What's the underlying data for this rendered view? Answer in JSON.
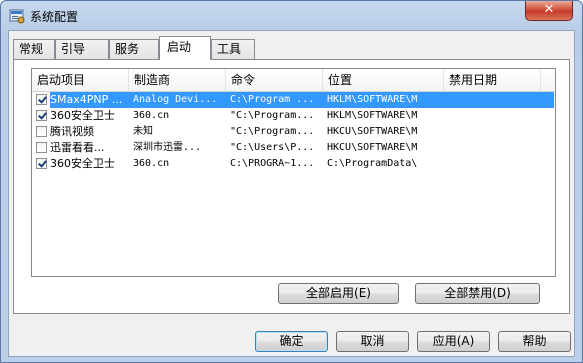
{
  "window": {
    "title": "系统配置",
    "close_label": "✕"
  },
  "tabs": [
    {
      "label": "常规",
      "active": false
    },
    {
      "label": "引导",
      "active": false
    },
    {
      "label": "服务",
      "active": false
    },
    {
      "label": "启动",
      "active": true
    },
    {
      "label": "工具",
      "active": false
    }
  ],
  "startup_list": {
    "columns": [
      "启动项目",
      "制造商",
      "命令",
      "位置",
      "禁用日期"
    ],
    "rows": [
      {
        "checked": true,
        "selected": true,
        "name": "SMax4PNP ...",
        "maker": "Analog Devi...",
        "command": "C:\\Program ...",
        "location": "HKLM\\SOFTWARE\\M...",
        "disabled_date": ""
      },
      {
        "checked": true,
        "selected": false,
        "name": "360安全卫士",
        "maker": "360.cn",
        "command": "\"C:\\Program...",
        "location": "HKLM\\SOFTWARE\\M...",
        "disabled_date": ""
      },
      {
        "checked": false,
        "selected": false,
        "name": "腾讯视频",
        "maker": "未知",
        "command": "\"C:\\Program...",
        "location": "HKCU\\SOFTWARE\\M...",
        "disabled_date": ""
      },
      {
        "checked": false,
        "selected": false,
        "name": "迅雷看看...",
        "maker": "深圳市迅雷...",
        "command": "\"C:\\Users\\P...",
        "location": "HKCU\\SOFTWARE\\M...",
        "disabled_date": ""
      },
      {
        "checked": true,
        "selected": false,
        "name": "360安全卫士",
        "maker": "360.cn",
        "command": "C:\\PROGRA~1...",
        "location": "C:\\ProgramData\\...",
        "disabled_date": ""
      }
    ]
  },
  "buttons": {
    "enable_all": "全部启用(E)",
    "disable_all": "全部禁用(D)",
    "ok": "确定",
    "cancel": "取消",
    "apply": "应用(A)",
    "help": "帮助"
  },
  "colors": {
    "selection": "#3399ff",
    "titlebar": "#b9cde8",
    "close": "#c4372a"
  }
}
